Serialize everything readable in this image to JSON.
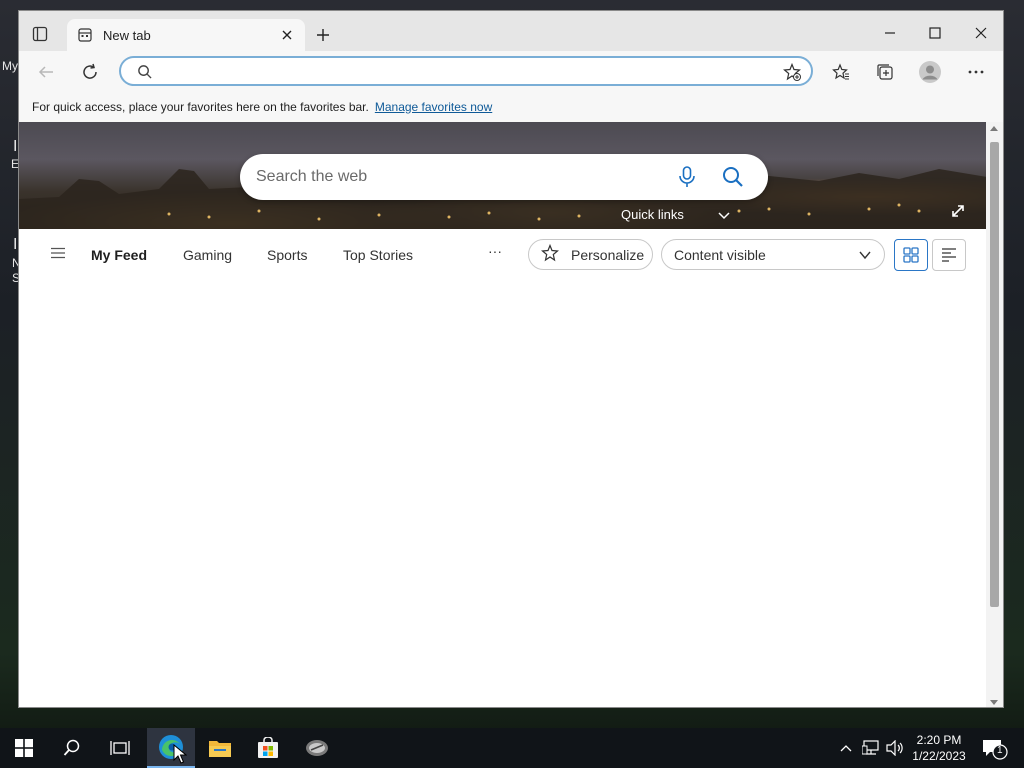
{
  "desktop": {
    "labels": [
      "My",
      "I",
      "E",
      "I",
      "N",
      "S"
    ]
  },
  "browser": {
    "tab_title": "New tab",
    "address_value": "",
    "favorites_bar_message": "For quick access, place your favorites here on the favorites bar.",
    "favorites_bar_link": "Manage favorites now"
  },
  "newtab": {
    "search_placeholder": "Search the web",
    "quick_links_label": "Quick links",
    "feed_nav": {
      "items": [
        "My Feed",
        "Gaming",
        "Sports",
        "Top Stories"
      ],
      "active": "My Feed",
      "more_label": "···",
      "personalize_label": "Personalize",
      "content_visibility": "Content visible"
    }
  },
  "taskbar": {
    "time": "2:20 PM",
    "date": "1/22/2023",
    "notification_count": "1",
    "apps": [
      "start-icon",
      "search-icon",
      "task-view-icon",
      "edge-icon",
      "file-explorer-icon",
      "store-icon",
      "app-icon"
    ]
  },
  "colors": {
    "accent": "#2a76c6",
    "link": "#0f5a98",
    "address_focus": "#7aaed6",
    "taskbar": "#101418"
  }
}
